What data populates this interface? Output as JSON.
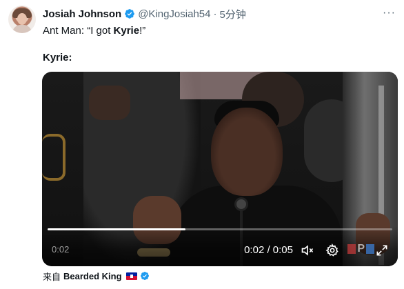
{
  "tweet": {
    "author_name": "Josiah Johnson",
    "author_handle": "@KingJosiah54",
    "separator": "·",
    "timestamp": "5分钟",
    "more_label": "···",
    "text_line1_prefix": "Ant Man: “I got ",
    "text_line1_bold": "Kyrie",
    "text_line1_suffix": "!”",
    "text_line2": "Kyrie:"
  },
  "video": {
    "elapsed_overlay": "0:02",
    "time_display": "0:02 / 0:05",
    "progress_fraction": 0.4,
    "watermark_letters": "P"
  },
  "source": {
    "prefix": "来自",
    "name": "Bearded King"
  },
  "colors": {
    "verified": "#1d9bf0",
    "text_primary": "#0f1419",
    "text_secondary": "#536471"
  },
  "icons": {
    "verified": "verified-badge-icon",
    "more": "more-icon",
    "mute": "volume-mute-icon",
    "settings": "settings-gear-icon",
    "pip": "picture-in-picture-icon",
    "fullscreen": "fullscreen-icon",
    "flag": "haiti-flag-icon"
  }
}
